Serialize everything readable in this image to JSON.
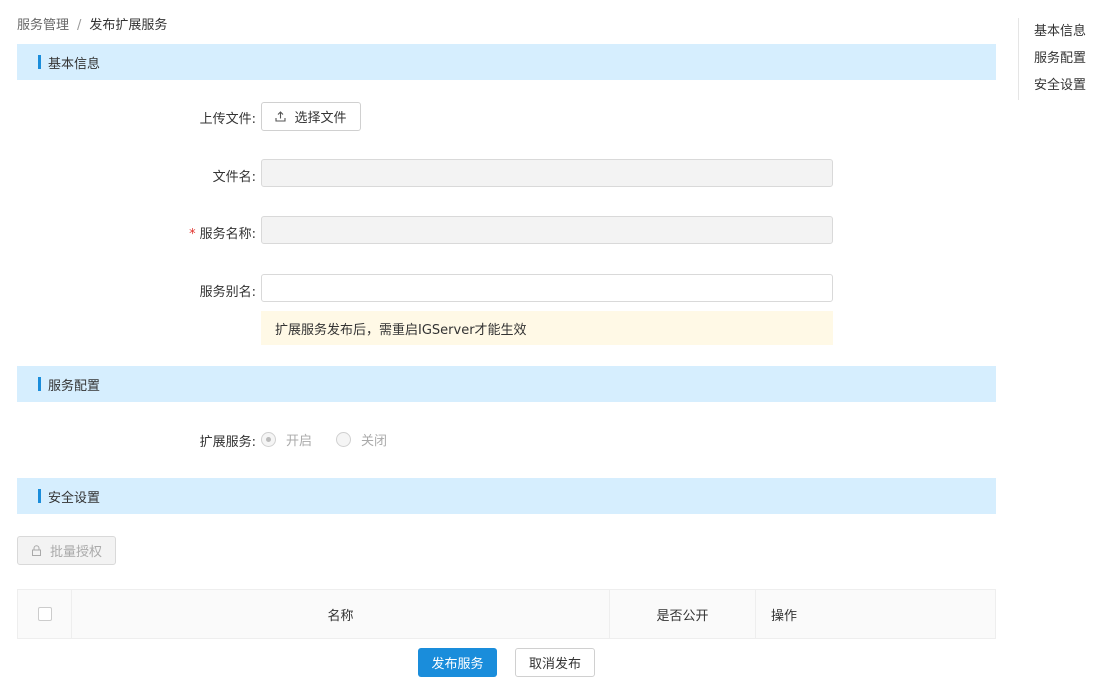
{
  "breadcrumb": {
    "parent": "服务管理",
    "separator": "/",
    "current": "发布扩展服务"
  },
  "sections": {
    "basic": "基本信息",
    "config": "服务配置",
    "security": "安全设置"
  },
  "form": {
    "upload_label": "上传文件:",
    "upload_button": "选择文件",
    "file_name_label": "文件名:",
    "file_name_value": "",
    "service_name_label": "服务名称:",
    "service_name_required": "*",
    "service_name_value": "",
    "service_alias_label": "服务别名:",
    "service_alias_value": "",
    "notice": "扩展服务发布后，需重启IGServer才能生效"
  },
  "config": {
    "ext_service_label": "扩展服务:",
    "options": [
      "开启",
      "关闭"
    ],
    "selected": "开启"
  },
  "security": {
    "batch_button": "批量授权",
    "table_headers": [
      "名称",
      "是否公开",
      "操作"
    ]
  },
  "actions": {
    "publish": "发布服务",
    "cancel": "取消发布"
  },
  "anchor_nav": [
    "基本信息",
    "服务配置",
    "安全设置"
  ],
  "colors": {
    "accent": "#1a8ddb",
    "section_bg": "#d6eefe",
    "notice_bg": "#fff9e6"
  },
  "icons": {
    "upload": "upload-icon",
    "lock": "lock-icon"
  }
}
